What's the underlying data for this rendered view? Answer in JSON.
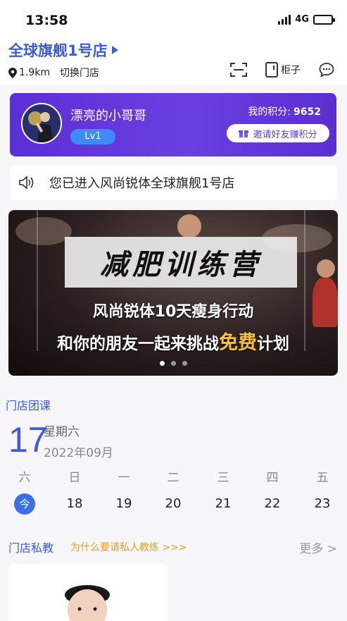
{
  "status": {
    "time": "13:58",
    "network": "4G"
  },
  "header": {
    "store_name": "全球旗舰1号店",
    "distance": "1.9km",
    "switch_label": "切换门店",
    "locker_label": "柜子"
  },
  "member": {
    "name": "漂亮的小哥哥",
    "level": "Lv1",
    "points_label": "我的积分:",
    "points": "9652",
    "invite_label": "邀请好友赚积分"
  },
  "notice": {
    "text": "您已进入风尚锐体全球旗舰1号店"
  },
  "banner": {
    "title": "减肥训练营",
    "line1": "风尚锐体10天瘦身行动",
    "line2_pre": "和你的朋友一起来挑战",
    "line2_highlight": "免费",
    "line2_post": "计划",
    "slide_count": 3,
    "active_slide": 1
  },
  "classes": {
    "title": "门店团课",
    "day": "17",
    "weekday": "星期六",
    "year_month": "2022年09月",
    "week": [
      {
        "label": "六",
        "num": "今",
        "today": true
      },
      {
        "label": "日",
        "num": "18"
      },
      {
        "label": "一",
        "num": "19"
      },
      {
        "label": "二",
        "num": "20"
      },
      {
        "label": "三",
        "num": "21"
      },
      {
        "label": "四",
        "num": "22"
      },
      {
        "label": "五",
        "num": "23"
      }
    ]
  },
  "private_training": {
    "title": "门店私教",
    "subtitle": "为什么要请私人教练 >>>",
    "more": "更多 >"
  },
  "colors": {
    "accent": "#3b5bdb",
    "card_purple": "#5b2fd6",
    "highlight": "#f7c22b"
  }
}
